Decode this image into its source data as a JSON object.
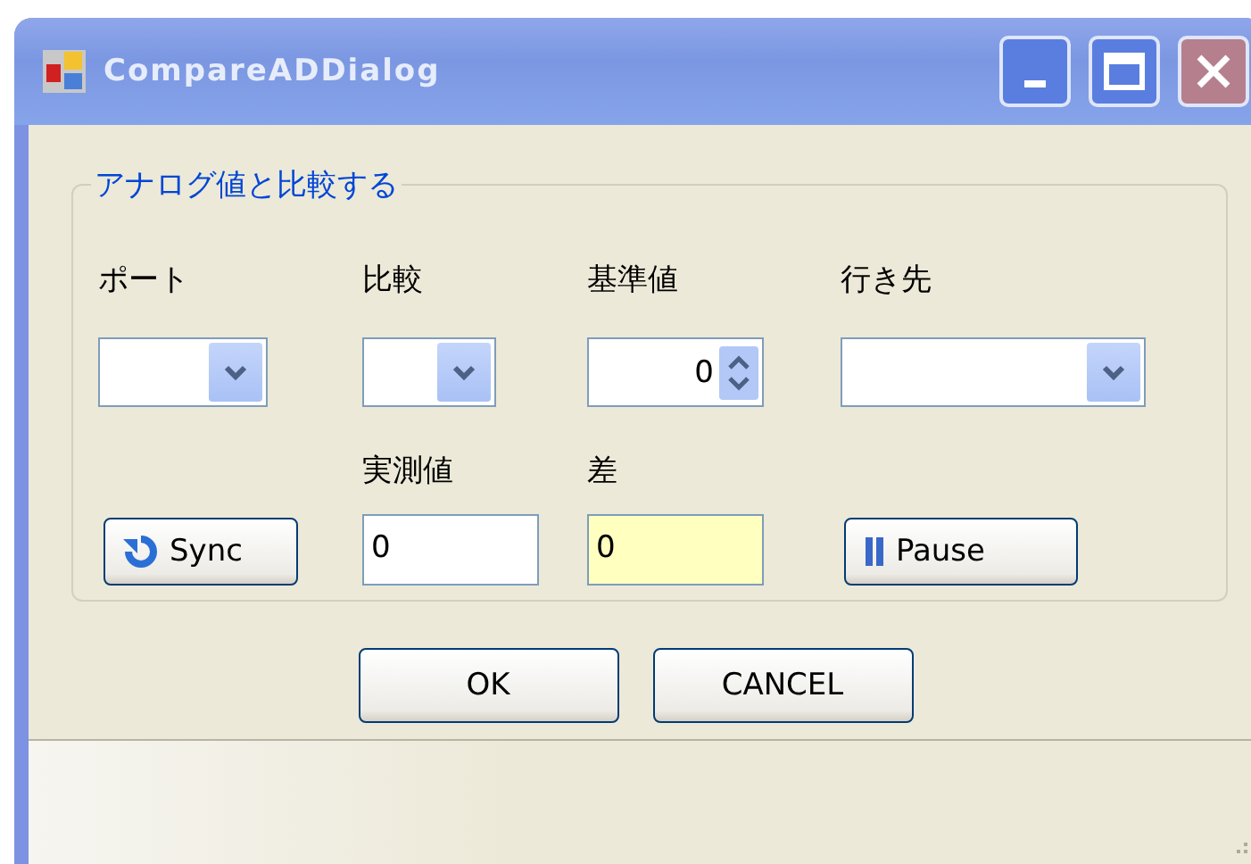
{
  "window": {
    "title": "CompareADDialog"
  },
  "group": {
    "legend": "アナログ値と比較する",
    "row1": [
      {
        "kind": "combo",
        "label": "ポート"
      },
      {
        "kind": "combo",
        "label": "比較"
      },
      {
        "kind": "spin",
        "label": "基準値",
        "value": "0"
      },
      {
        "kind": "combo",
        "label": "行き先"
      }
    ],
    "row2": [
      {
        "kind": "button",
        "text": "Sync"
      },
      {
        "kind": "field",
        "label": "実測値",
        "value": "0",
        "highlighted": false
      },
      {
        "kind": "field",
        "label": "差",
        "value": "0",
        "highlighted": true
      },
      {
        "kind": "button",
        "text": "Pause"
      }
    ]
  },
  "buttons": [
    "OK",
    "CANCEL"
  ]
}
